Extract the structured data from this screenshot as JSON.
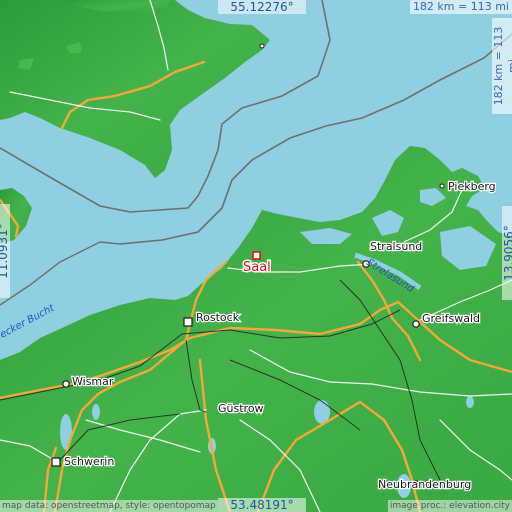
{
  "map": {
    "coords": {
      "top": "55.12276°",
      "bottom": "53.48191°",
      "left": "11.0931°",
      "right": "13.9056°"
    },
    "scale": "182 km = 113 mi",
    "attribution_left": "map data: openstreetmap, style: opentopomap",
    "attribution_right": "image proc.: elevation.city",
    "place": {
      "name": "Saal",
      "marker": "red-square-marker"
    },
    "cities": {
      "rostock": "Rostock",
      "stralsund": "Stralsund",
      "greifswald": "Greifswald",
      "wismar": "Wismar",
      "schwerin": "Schwerin",
      "gustrow": "Güstrow",
      "neubrandenburg": "Neubrandenburg",
      "piekberg": "Piekberg"
    },
    "water": {
      "bay": "ecker Bucht",
      "strelasund": "Strelasund"
    },
    "colors": {
      "water": "#8fcfe1",
      "land": "#3fae46",
      "road_primary": "#f2a93b",
      "road_secondary": "#ffffff",
      "border": "#6f6f6f",
      "marker": "#d41a1a"
    }
  }
}
